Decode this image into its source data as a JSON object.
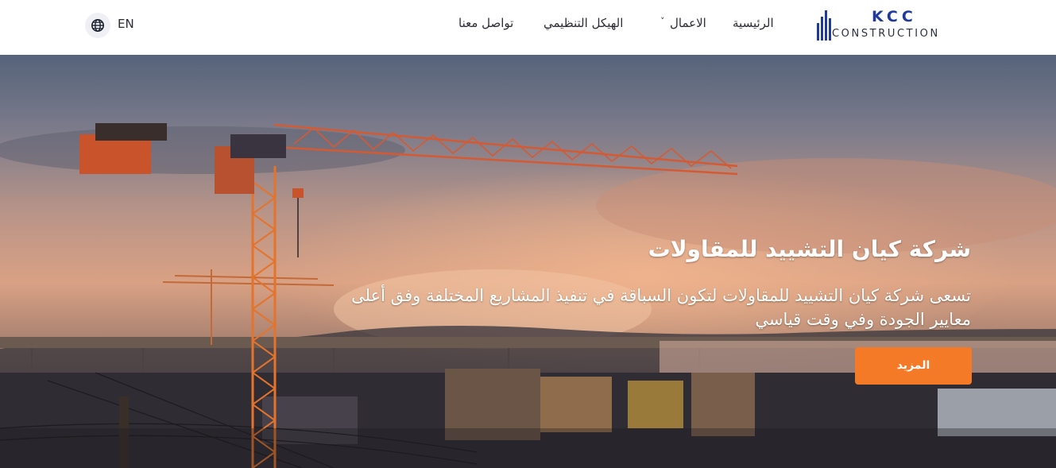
{
  "brand": {
    "logo_main": "KCC",
    "logo_sub": "CONSTRUCTION",
    "brand_color": "#1f3a9c"
  },
  "nav": {
    "home": "الرئيسية",
    "works": "الاعمال",
    "org": "الهيكل التنظيمي",
    "contact": "تواصل معنا",
    "works_chevron": "˅"
  },
  "language": {
    "label": "EN",
    "icon": "globe-icon"
  },
  "hero": {
    "title": "شركة كيان التشييد للمقاولات",
    "description": "تسعى شركة كيان التشييد للمقاولات لتكون السباقة في تنفيذ المشاريع المختلفة وفق أعلى معايير الجودة وفي وقت قياسي",
    "button": "المزيد",
    "accent_color": "#f47a27"
  }
}
